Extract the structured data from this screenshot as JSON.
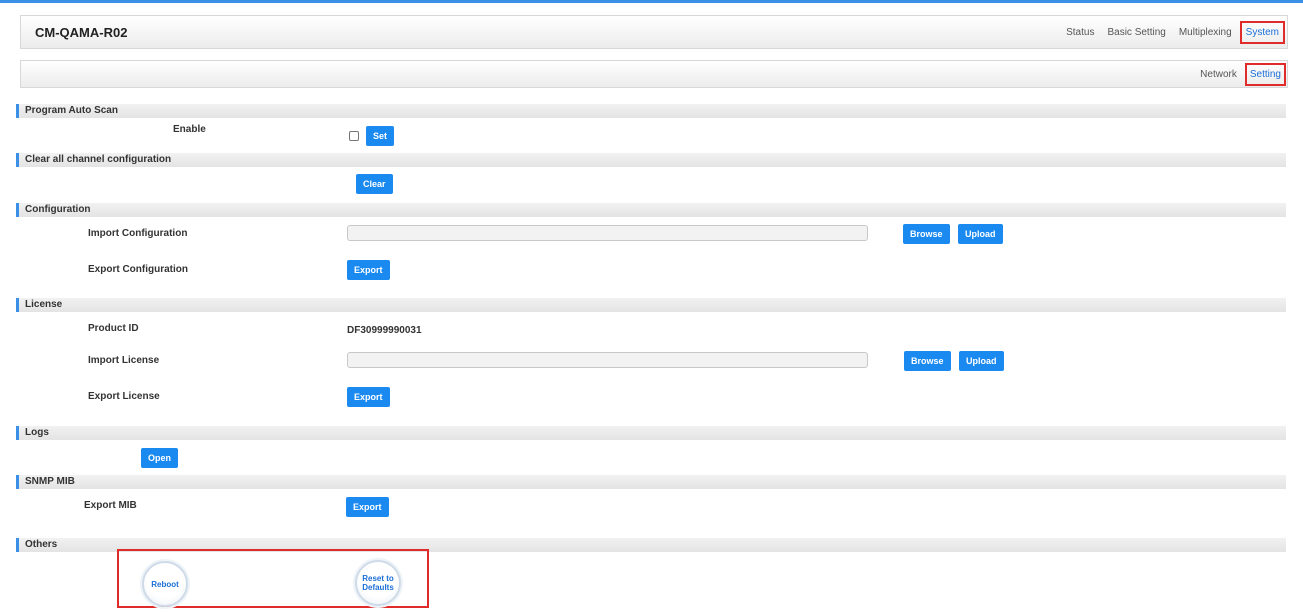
{
  "header": {
    "title": "CM-QAMA-R02",
    "nav": [
      "Status",
      "Basic Setting",
      "Multiplexing",
      "System"
    ],
    "subnav": [
      "Network",
      "Setting"
    ]
  },
  "sections": {
    "auto_scan": {
      "title": "Program Auto Scan",
      "enable_label": "Enable",
      "enable_checked": false,
      "set_label": "Set"
    },
    "clear_all": {
      "title": "Clear all channel configuration",
      "clear_label": "Clear"
    },
    "configuration": {
      "title": "Configuration",
      "import_label": "Import Configuration",
      "import_value": "",
      "browse_label": "Browse",
      "upload_label": "Upload",
      "export_label": "Export Configuration",
      "export_button": "Export"
    },
    "license": {
      "title": "License",
      "product_id_label": "Product ID",
      "product_id_value": "DF30999990031",
      "import_label": "Import License",
      "import_value": "",
      "browse_label": "Browse",
      "upload_label": "Upload",
      "export_label": "Export License",
      "export_button": "Export"
    },
    "logs": {
      "title": "Logs",
      "open_label": "Open"
    },
    "snmp": {
      "title": "SNMP MIB",
      "export_label": "Export MIB",
      "export_button": "Export"
    },
    "others": {
      "title": "Others",
      "reboot_label": "Reboot",
      "reset_label": "Reset to\nDefaults"
    }
  },
  "colors": {
    "accent": "#1a8af0",
    "highlight": "#e02b2b"
  }
}
